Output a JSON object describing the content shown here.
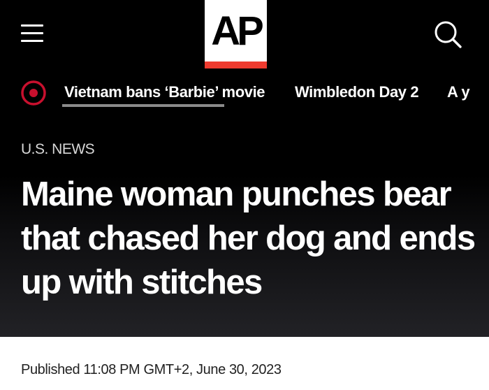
{
  "header": {
    "menu_icon": "hamburger-menu-icon",
    "logo_text": "AP",
    "search_icon": "search-icon",
    "colors": {
      "logo_bar": "#ef3b2f",
      "live_dot": "#c8102e"
    }
  },
  "trending": {
    "icon": "live-indicator-icon",
    "items": [
      {
        "label": "Vietnam bans ‘Barbie’ movie"
      },
      {
        "label": "Wimbledon Day 2"
      },
      {
        "label": "A y"
      }
    ]
  },
  "article": {
    "section": "U.S. NEWS",
    "headline": "Maine woman punches bear that chased her dog and ends up with stitches",
    "published": "Published 11:08 PM GMT+2, June 30, 2023"
  }
}
